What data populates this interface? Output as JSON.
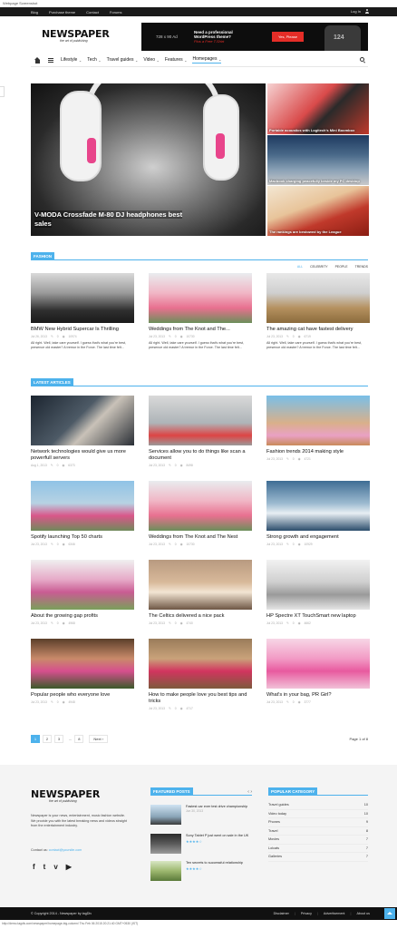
{
  "capture_title": "Webpage Screenshot",
  "capture_footer": "http://demo.tagdiv.com/newspaper/homepage-big-column/ Thu Feb 06 2015 20:21:40 GMT+0530 (IST)",
  "topbar": {
    "links": [
      "Blog",
      "Purchase theme",
      "Contact",
      "Forums"
    ],
    "login": "Log In",
    "icon": "user-icon"
  },
  "logo": {
    "name": "NEWSPAPER",
    "tagline": "the art of publishing"
  },
  "ad": {
    "size": "728 x 90 Ad",
    "line1": "Need a professional",
    "line2": "WordPress theme?",
    "line3": "Plus a Free T-Shirt",
    "button": "Yes, Please"
  },
  "nav": {
    "items": [
      {
        "label": "Lifestyle",
        "chevron": "chevron-down-icon"
      },
      {
        "label": "Tech",
        "chevron": "chevron-down-icon"
      },
      {
        "label": "Travel guides",
        "chevron": "chevron-down-icon"
      },
      {
        "label": "Video",
        "chevron": "chevron-down-icon"
      },
      {
        "label": "Features",
        "chevron": "chevron-down-icon"
      },
      {
        "label": "Homepages",
        "chevron": "chevron-down-icon"
      }
    ],
    "active": "Homepages",
    "chev": "⌄"
  },
  "hero": {
    "main_title": "V-MODA Crossfade M-80 DJ headphones best sales",
    "side": [
      {
        "title": "Portable acoustics with Logitech's Mini Boombox"
      },
      {
        "title": "Macbook charging peacefully beside my PC desktop"
      },
      {
        "title": "The rankings are bestowed by the League"
      }
    ]
  },
  "fashion": {
    "label": "FASHION",
    "filters": [
      "ALL",
      "CELEBRITY",
      "PEOPLE",
      "TRENDS"
    ],
    "selected_filter": "ALL",
    "cards": [
      {
        "title": "BMW New Hybrid Supercar Is Thrilling",
        "date": "Jul 26, 2013",
        "comments": "0",
        "views": "10974",
        "excerpt": "All right. Well, take care yourself. I guess that's what you're best, presence old master? A tremor in the Force. The last time felt..."
      },
      {
        "title": "Weddings from The Knot and The...",
        "date": "Jul 23, 2013",
        "comments": "0",
        "views": "10730",
        "excerpt": "All right. Well, take care yourself. I guess that's what you're best, presence old master? A tremor in the Force. The last time felt..."
      },
      {
        "title": "The amazing cat have fastest delivery",
        "date": "Jul 23, 2013",
        "comments": "0",
        "views": "6719",
        "excerpt": "All right. Well, take care yourself. I guess that's what you're best, presence old master? A tremor in the Force. The last time felt..."
      }
    ]
  },
  "latest": {
    "label": "LATEST ARTICLES",
    "cards": [
      {
        "title": "Network technologies would give us more powerfull servers",
        "date": "Aug 1, 2013",
        "comments": "0",
        "views": "6373"
      },
      {
        "title": "Services allow you to do things like scan a document",
        "date": "Jul 23, 2013",
        "comments": "0",
        "views": "8498"
      },
      {
        "title": "Fashion trends 2014 making style",
        "date": "Jul 23, 2013",
        "comments": "0",
        "views": "4721"
      },
      {
        "title": "Spotify launching Top 50 charts",
        "date": "Jul 23, 2013",
        "comments": "0",
        "views": "6346"
      },
      {
        "title": "Weddings from The Knot and The Nest",
        "date": "Jul 23, 2013",
        "comments": "0",
        "views": "10730"
      },
      {
        "title": "Strong growth and engagement",
        "date": "Jul 23, 2013",
        "comments": "0",
        "views": "10929"
      },
      {
        "title": "About the growing gap profits",
        "date": "Jul 23, 2013",
        "comments": "0",
        "views": "4968"
      },
      {
        "title": "The Celtics delivered a nice pack",
        "date": "Jul 23, 2013",
        "comments": "0",
        "views": "4740"
      },
      {
        "title": "HP Spectre XT TouchSmart new laptop",
        "date": "Jul 23, 2013",
        "comments": "0",
        "views": "4662"
      },
      {
        "title": "Popular people who everyone love",
        "date": "Jul 23, 2013",
        "comments": "0",
        "views": "4948"
      },
      {
        "title": "How to make people love you best tips and tricks",
        "date": "Jul 23, 2013",
        "comments": "0",
        "views": "4717"
      },
      {
        "title": "What's in your bag, PR Girl?",
        "date": "Jul 23, 2013",
        "comments": "0",
        "views": "3777"
      }
    ]
  },
  "meta_icons": {
    "comments": "comment-icon",
    "views": "eye-icon"
  },
  "pagination": {
    "pages": [
      "1",
      "2",
      "3"
    ],
    "ellipsis": "...",
    "last": "8",
    "next": "Next",
    "next_arrow": "›",
    "page_of": "Page 1 of 8"
  },
  "footer": {
    "logo": "NEWSPAPER",
    "tagline": "the art of publishing",
    "about": "Newspaper is your news, entertainment, music fashion website. We provide you with the latest breaking news and videos straight from the entertainment industry.",
    "contact_label": "Contact us:",
    "contact_email": "contact@yoursite.com",
    "social": [
      "f",
      "t",
      "v",
      "yt"
    ],
    "social_icons": [
      "facebook-icon",
      "twitter-icon",
      "vimeo-icon",
      "youtube-icon"
    ],
    "featured": {
      "label": "FEATURED POSTS",
      "posts": [
        {
          "title": "Fastest car ever test drive championship",
          "date": "Jun 30, 2013",
          "stars": ""
        },
        {
          "title": "Sony Tablet P just went on sale in the UK",
          "date": "",
          "stars": "★★★★☆"
        },
        {
          "title": "Ten secrets to successful relationship",
          "date": "",
          "stars": "★★★★☆"
        }
      ]
    },
    "popular": {
      "label": "POPULAR CATEGORY",
      "items": [
        {
          "name": "Travel guides",
          "count": "10"
        },
        {
          "name": "Video today",
          "count": "10"
        },
        {
          "name": "Phones",
          "count": "9"
        },
        {
          "name": "Travel",
          "count": "8"
        },
        {
          "name": "Movies",
          "count": "7"
        },
        {
          "name": "Lolcats",
          "count": "7"
        },
        {
          "name": "Galleries",
          "count": "7"
        }
      ]
    }
  },
  "bottombar": {
    "copyright": "© Copyright 2014 - Newspaper by tagDiv",
    "links": [
      "Disclaimer",
      "Privacy",
      "Advertisement",
      "About us"
    ],
    "separator": "|"
  },
  "colors": {
    "accent": "#4db2ec",
    "topbar": "#1a1a1a",
    "ad_red": "#e52d27"
  }
}
